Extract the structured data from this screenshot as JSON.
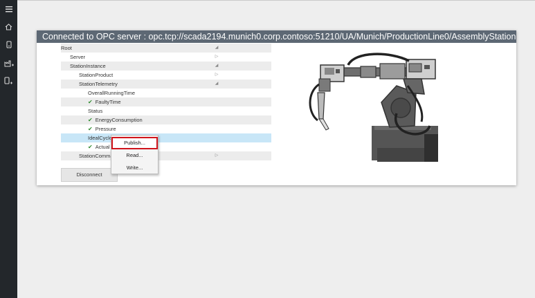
{
  "sidebar": {
    "items": [
      {
        "icon": "hamburger-menu-icon"
      },
      {
        "icon": "home-icon"
      },
      {
        "icon": "device-icon"
      },
      {
        "icon": "factory-add-icon"
      },
      {
        "icon": "device-add-icon"
      }
    ]
  },
  "header": {
    "title": "Connected to OPC server : opc.tcp://scada2194.munich0.corp.contoso:51210/UA/Munich/ProductionLine0/AssemblyStation"
  },
  "tree": {
    "nodes": [
      {
        "label": "Root",
        "level": 0,
        "arrow": "expanded",
        "checked": false
      },
      {
        "label": "Server",
        "level": 1,
        "arrow": "collapsed",
        "checked": false
      },
      {
        "label": "StationInstance",
        "level": 1,
        "arrow": "expanded",
        "checked": false
      },
      {
        "label": "StationProduct",
        "level": 2,
        "arrow": "collapsed",
        "checked": false
      },
      {
        "label": "StationTelemetry",
        "level": 2,
        "arrow": "expanded",
        "checked": false
      },
      {
        "label": "OverallRunningTime",
        "level": 3,
        "arrow": "none",
        "checked": false
      },
      {
        "label": "FaultyTime",
        "level": 3,
        "arrow": "none",
        "checked": true
      },
      {
        "label": "Status",
        "level": 3,
        "arrow": "none",
        "checked": false
      },
      {
        "label": "EnergyConsumption",
        "level": 3,
        "arrow": "none",
        "checked": true
      },
      {
        "label": "Pressure",
        "level": 3,
        "arrow": "none",
        "checked": true
      },
      {
        "label": "IdealCycleTi",
        "level": 3,
        "arrow": "none",
        "checked": false,
        "selected": true
      },
      {
        "label": "Actual",
        "level": 3,
        "arrow": "none",
        "checked": true
      },
      {
        "label": "StationComma",
        "level": 2,
        "arrow": "collapsed",
        "checked": false
      }
    ]
  },
  "buttons": {
    "disconnect_label": "Disconnect"
  },
  "context_menu": {
    "publish_label": "Publish...",
    "read_label": "Read...",
    "write_label": "Write..."
  },
  "colors": {
    "header_bg": "#5d6874",
    "sidebar_bg": "#23272b",
    "selected_row": "#c8e6f7",
    "check_green": "#2e8b2e",
    "menu_highlight_border": "#d0141b"
  }
}
